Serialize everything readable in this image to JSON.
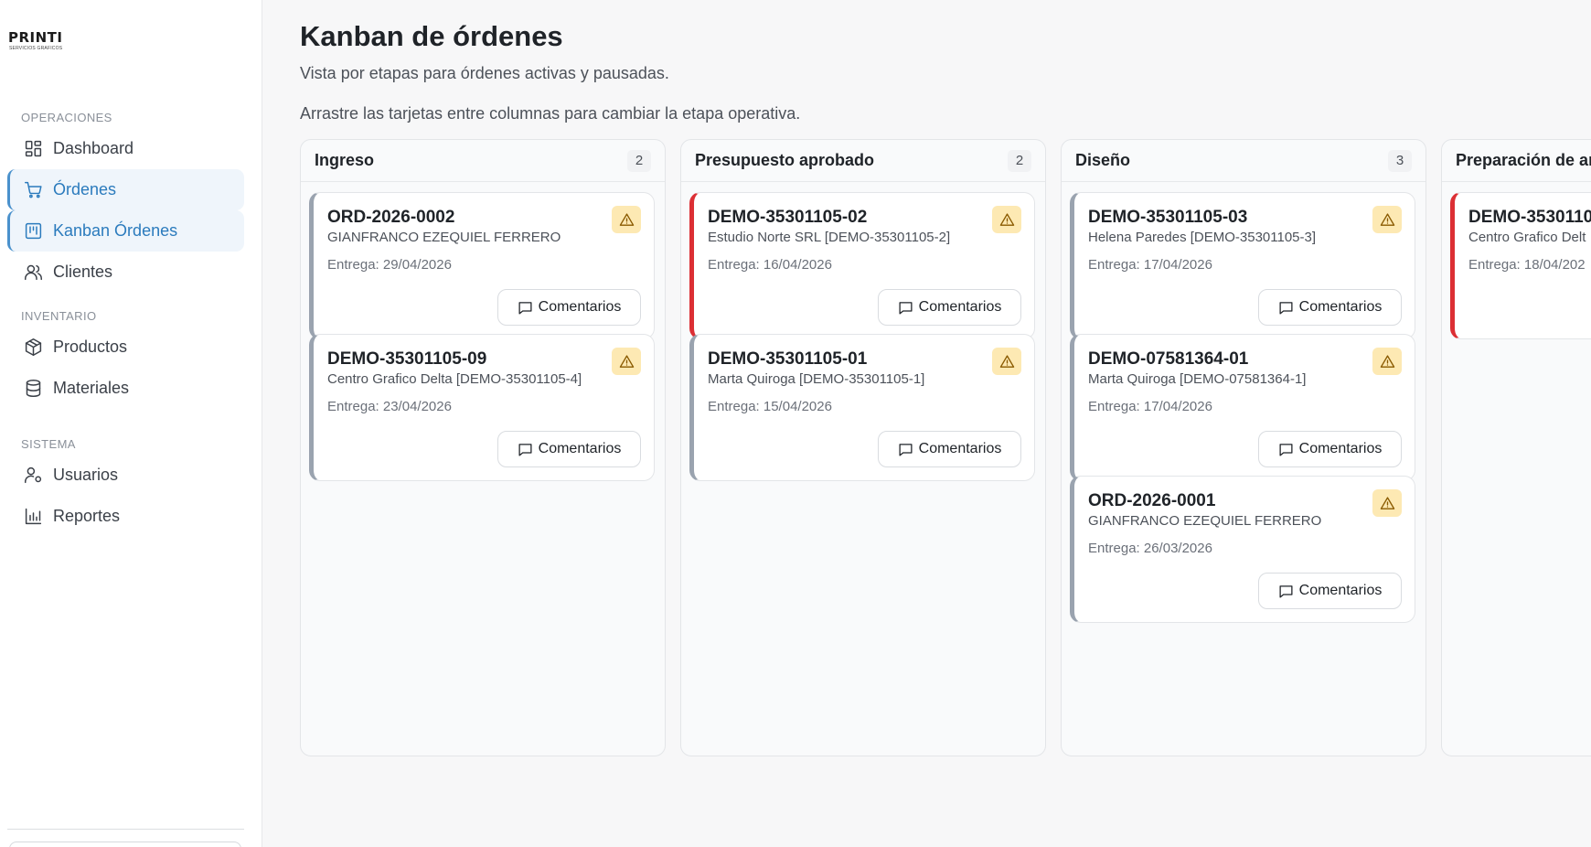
{
  "brand": {
    "name": "PRINTI",
    "tagline": "SERVICIOS GRAFICOS"
  },
  "sidebar": {
    "sections": [
      {
        "title": "OPERACIONES"
      },
      {
        "title": "INVENTARIO"
      },
      {
        "title": "SISTEMA"
      }
    ],
    "items": [
      {
        "label": "Dashboard",
        "icon": "dashboard-icon"
      },
      {
        "label": "Órdenes",
        "icon": "cart-icon"
      },
      {
        "label": "Kanban Órdenes",
        "icon": "kanban-icon"
      },
      {
        "label": "Clientes",
        "icon": "users-icon"
      },
      {
        "label": "Productos",
        "icon": "box-icon"
      },
      {
        "label": "Materiales",
        "icon": "database-icon"
      },
      {
        "label": "Usuarios",
        "icon": "user-gear-icon"
      },
      {
        "label": "Reportes",
        "icon": "bar-chart-icon"
      }
    ]
  },
  "page": {
    "title": "Kanban de órdenes",
    "subtitle": "Vista por etapas para órdenes activas y pausadas.",
    "hint": "Arrastre las tarjetas entre columnas para cambiar la etapa operativa."
  },
  "colors": {
    "accent": "#2b7bbd",
    "urgent": "#dc2f34",
    "normal": "#9aa3af",
    "warning": "#fde9b3"
  },
  "columns": [
    {
      "title": "Ingreso",
      "count": "2",
      "cards": [
        {
          "code": "ORD-2026-0002",
          "client": "GIANFRANCO EZEQUIEL FERRERO",
          "delivery": "Entrega: 29/04/2026",
          "comments": "Comentarios",
          "urgent": false
        },
        {
          "code": "DEMO-35301105-09",
          "client": "Centro Grafico Delta [DEMO-35301105-4]",
          "delivery": "Entrega: 23/04/2026",
          "comments": "Comentarios",
          "urgent": false
        }
      ]
    },
    {
      "title": "Presupuesto aprobado",
      "count": "2",
      "cards": [
        {
          "code": "DEMO-35301105-02",
          "client": "Estudio Norte SRL [DEMO-35301105-2]",
          "delivery": "Entrega: 16/04/2026",
          "comments": "Comentarios",
          "urgent": true
        },
        {
          "code": "DEMO-35301105-01",
          "client": "Marta Quiroga [DEMO-35301105-1]",
          "delivery": "Entrega: 15/04/2026",
          "comments": "Comentarios",
          "urgent": false
        }
      ]
    },
    {
      "title": "Diseño",
      "count": "3",
      "cards": [
        {
          "code": "DEMO-35301105-03",
          "client": "Helena Paredes [DEMO-35301105-3]",
          "delivery": "Entrega: 17/04/2026",
          "comments": "Comentarios",
          "urgent": false
        },
        {
          "code": "DEMO-07581364-01",
          "client": "Marta Quiroga [DEMO-07581364-1]",
          "delivery": "Entrega: 17/04/2026",
          "comments": "Comentarios",
          "urgent": false
        },
        {
          "code": "ORD-2026-0001",
          "client": "GIANFRANCO EZEQUIEL FERRERO",
          "delivery": "Entrega: 26/03/2026",
          "comments": "Comentarios",
          "urgent": false
        }
      ]
    },
    {
      "title": "Preparación de ar",
      "count": "",
      "cards": [
        {
          "code": "DEMO-3530110",
          "client": "Centro Grafico Delt",
          "delivery": "Entrega: 18/04/202",
          "comments": "Comentarios",
          "urgent": true
        }
      ]
    }
  ]
}
